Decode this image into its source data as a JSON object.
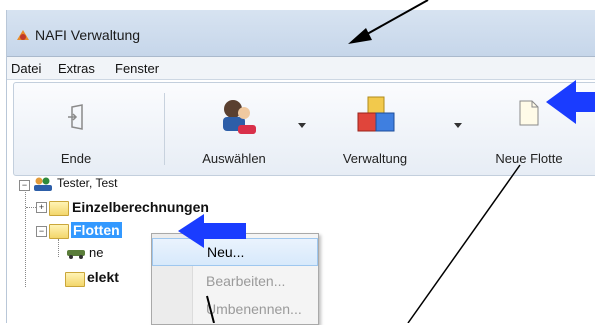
{
  "window": {
    "title": "NAFI Verwaltung"
  },
  "menu": [
    "Datei",
    "Extras",
    "Fenster"
  ],
  "toolbar": {
    "end_label": "Ende",
    "select_label": "Auswählen",
    "admin_label": "Verwaltung",
    "new_fleet_label": "Neue Flotte"
  },
  "tree": {
    "root": "Tester, Test",
    "single_calc": "Einzelberechnungen",
    "fleets": "Flotten",
    "child_partial": "ne",
    "elect_partial": "elekt"
  },
  "context_menu": {
    "items": [
      {
        "label": "Neu...",
        "enabled": true
      },
      {
        "label": "Bearbeiten...",
        "enabled": false
      },
      {
        "label": "Umbenennen...",
        "enabled": false
      }
    ]
  },
  "colors": {
    "annotation_arrow": "#1a3cff",
    "selection": "#3399ff"
  },
  "annotations": {
    "arrows": [
      "black-arrow-to-title",
      "blue-arrow-to-new-fleet",
      "blue-arrow-to-fleets-node",
      "black-line-to-context-menu",
      "black-line-to-new-fleet"
    ]
  }
}
